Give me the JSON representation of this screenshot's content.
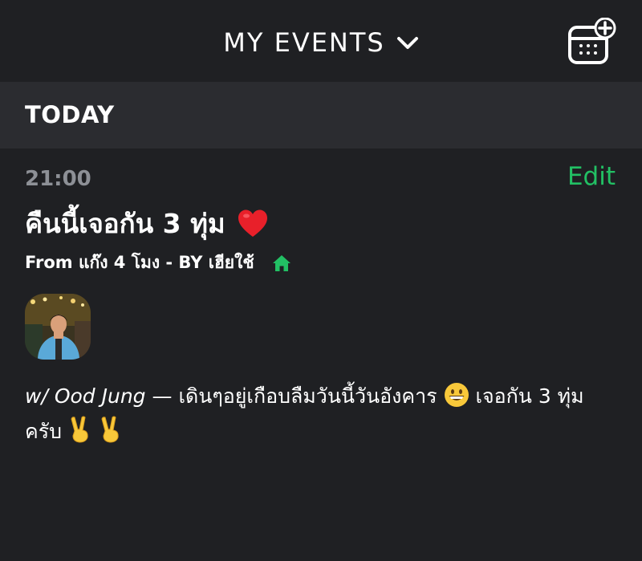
{
  "header": {
    "title": "MY EVENTS",
    "dropdown_icon": "chevron-down-icon",
    "add_event_icon": "calendar-plus-icon"
  },
  "section": {
    "label": "TODAY"
  },
  "event": {
    "time": "21:00",
    "edit_label": "Edit",
    "title": "คืนนี้เจอกัน 3 ทุ่ม",
    "title_emoji": "heart-icon",
    "meta_from": "From แก๊ง 4 โมง - BY เฮียใช้",
    "location_icon": "home-icon",
    "with_label": "w/ Ood Jung",
    "note_separator": " — ",
    "note_text_1": "เดินๆอยู่เกือบลืมวันนี้วันอังคาร",
    "note_text_2": "เจอกัน 3 ทุ่มครับ"
  },
  "colors": {
    "background": "#1f2023",
    "section_bg": "#2b2c30",
    "accent_green": "#22c064",
    "time_gray": "#8d9096"
  }
}
